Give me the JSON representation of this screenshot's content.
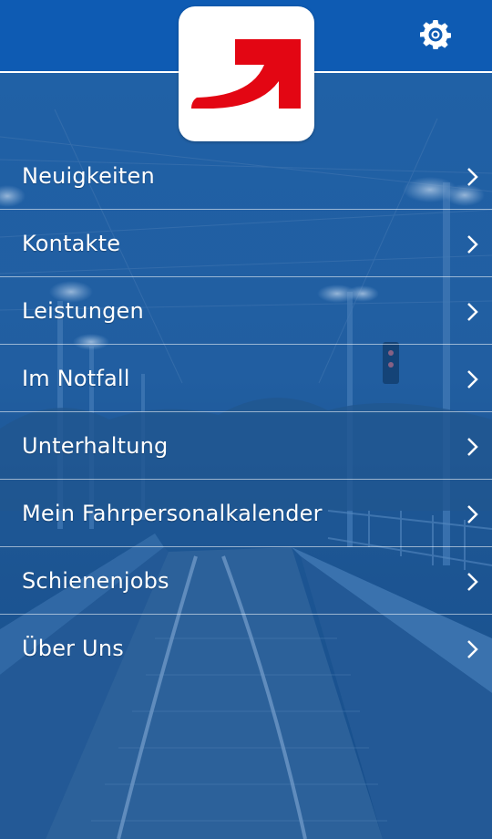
{
  "app": {
    "logo_icon": "arrow-logo-icon",
    "settings_icon": "gear-icon"
  },
  "colors": {
    "header": "#0e5bb3",
    "logo_red": "#e30613",
    "overlay_blue": "#1b5a9c",
    "text": "#ffffff"
  },
  "menu": [
    {
      "label": "Neuigkeiten",
      "icon": "chevron-right-icon"
    },
    {
      "label": "Kontakte",
      "icon": "chevron-right-icon"
    },
    {
      "label": "Leistungen",
      "icon": "chevron-right-icon"
    },
    {
      "label": "Im Notfall",
      "icon": "chevron-right-icon"
    },
    {
      "label": "Unterhaltung",
      "icon": "chevron-right-icon"
    },
    {
      "label": "Mein Fahrpersonalkalender",
      "icon": "chevron-right-icon"
    },
    {
      "label": "Schienenjobs",
      "icon": "chevron-right-icon"
    },
    {
      "label": "Über Uns",
      "icon": "chevron-right-icon"
    }
  ]
}
